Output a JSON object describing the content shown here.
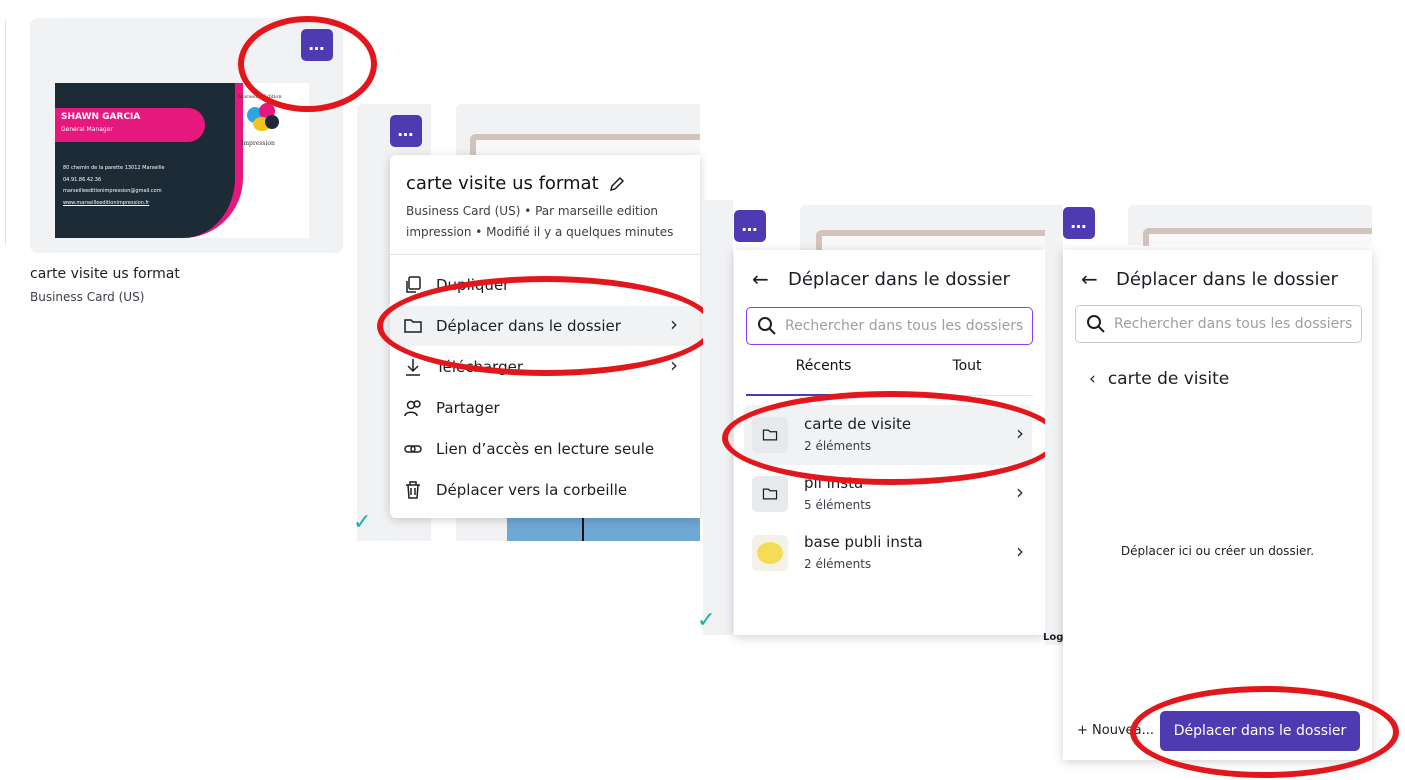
{
  "design": {
    "title": "carte visite us format",
    "subtitle": "Business Card (US)"
  },
  "business_card": {
    "name": "SHAWN GARCIA",
    "role": "General Manager",
    "brand_top": "Marseille Edition",
    "brand_bottom": "Impression",
    "address": "80 chemin de la parette 13012 Marseille",
    "phone": "04.91.86.42.36",
    "email": "marseilleeditionimpression@gmail.com",
    "website": "www.marseilleeditionimpression.fr"
  },
  "context_menu": {
    "title": "carte visite us format",
    "meta": "Business Card (US) • Par marseille edition impression • Modifié il y a quelques minutes",
    "items": [
      {
        "label": "Dupliquer",
        "icon": "copy-icon"
      },
      {
        "label": "Déplacer dans le dossier",
        "icon": "folder-icon"
      },
      {
        "label": "Télécharger",
        "icon": "download-icon"
      },
      {
        "label": "Partager",
        "icon": "share-people-icon"
      },
      {
        "label": "Lien d’accès en lecture seule",
        "icon": "link-icon"
      },
      {
        "label": "Déplacer vers la corbeille",
        "icon": "trash-icon"
      }
    ]
  },
  "move_panel": {
    "title": "Déplacer dans le dossier",
    "search_placeholder": "Rechercher dans tous les dossiers",
    "tabs": [
      "Récents",
      "Tout"
    ],
    "folders": [
      {
        "name": "carte de visite",
        "count": "2 éléments"
      },
      {
        "name": "pli insta",
        "count": "5 éléments"
      },
      {
        "name": "base publi insta",
        "count": "2 éléments"
      }
    ]
  },
  "folder_panel": {
    "title": "Déplacer dans le dossier",
    "search_placeholder": "Rechercher dans tous les dossiers",
    "back_folder": "carte de visite",
    "empty_text": "Déplacer ici ou créer un dossier.",
    "new_label": "+ Nouvea...",
    "confirm_button": "Déplacer dans le dossier"
  },
  "colors": {
    "accent": "#4f3bb1",
    "highlight": "#e3171b",
    "card_dark": "#1c2b36",
    "card_pink": "#e6187d"
  }
}
